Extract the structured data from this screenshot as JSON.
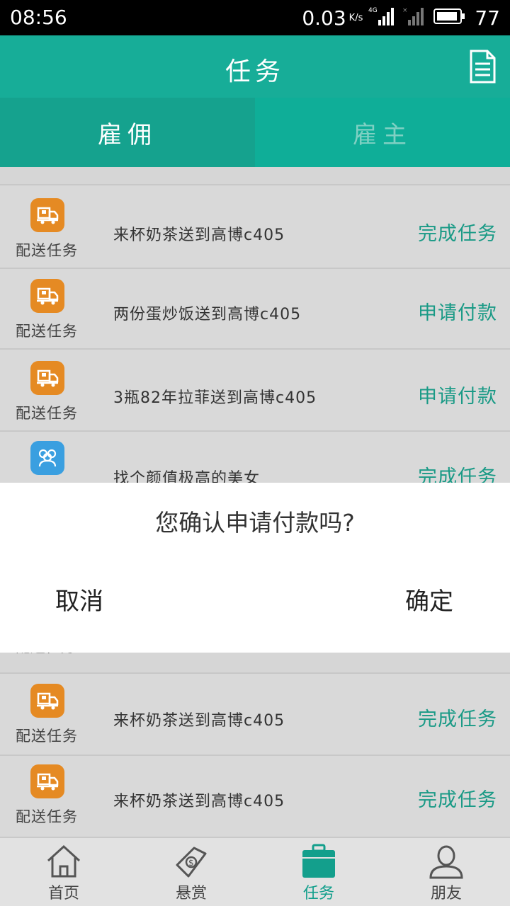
{
  "status_bar": {
    "time": "08:56",
    "net_speed": "0.03",
    "net_unit": "K/s",
    "network_type": "4G",
    "battery": "77"
  },
  "header": {
    "title": "任务",
    "action_icon": "document-icon"
  },
  "tabs": [
    {
      "label": "雇佣",
      "active": true
    },
    {
      "label": "雇主",
      "active": false
    }
  ],
  "tasks": [
    {
      "type": "配送任务",
      "icon": "delivery-truck-icon",
      "color": "#e58a23",
      "desc": "来杯奶茶送到高博c405",
      "action": "完成任务"
    },
    {
      "type": "配送任务",
      "icon": "delivery-truck-icon",
      "color": "#e58a23",
      "desc": "两份蛋炒饭送到高博c405",
      "action": "申请付款"
    },
    {
      "type": "配送任务",
      "icon": "delivery-truck-icon",
      "color": "#e58a23",
      "desc": "3瓶82年拉菲送到高博c405",
      "action": "申请付款"
    },
    {
      "type": "",
      "icon": "people-group-icon",
      "color": "#3a9fe0",
      "desc": "找个颜值极高的美女",
      "action": "完成任务"
    },
    {
      "type": "配送任务",
      "icon": "delivery-truck-icon",
      "color": "#e58a23",
      "desc": "来杯奶茶送到高博c405",
      "action": "完成任务"
    },
    {
      "type": "配送任务",
      "icon": "delivery-truck-icon",
      "color": "#e58a23",
      "desc": "来杯奶茶送到高博c405",
      "action": "完成任务"
    }
  ],
  "peek_text": "配送任务",
  "dialog": {
    "message": "您确认申请付款吗?",
    "cancel": "取消",
    "confirm": "确定"
  },
  "bottom_nav": [
    {
      "label": "首页",
      "icon": "home-icon",
      "active": false
    },
    {
      "label": "悬赏",
      "icon": "reward-money-icon",
      "active": false
    },
    {
      "label": "任务",
      "icon": "task-bag-icon",
      "active": true
    },
    {
      "label": "朋友",
      "icon": "person-icon",
      "active": false
    }
  ],
  "colors": {
    "primary": "#17ad98",
    "accent_text": "#1a9a86",
    "delivery_icon": "#e58a23",
    "people_icon": "#3a9fe0"
  }
}
